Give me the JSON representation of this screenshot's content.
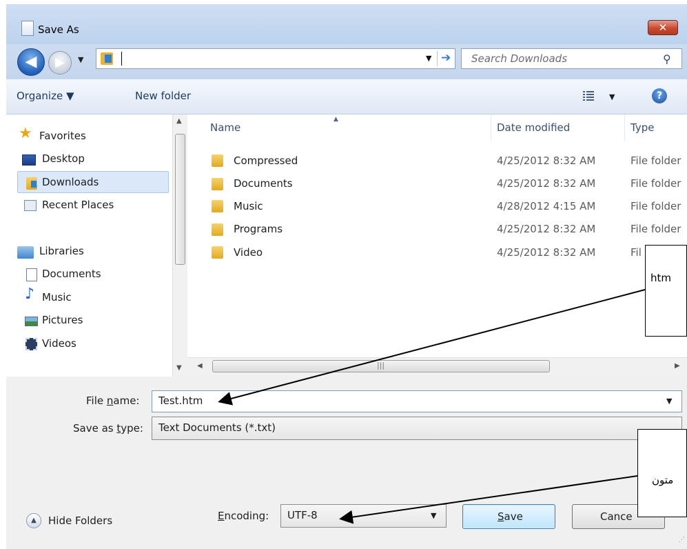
{
  "window": {
    "title": "Save As",
    "close_glyph": "✕"
  },
  "nav": {
    "back_glyph": "◀",
    "forward_glyph": "▶",
    "address_value": "",
    "search_placeholder": "Search Downloads"
  },
  "toolbar": {
    "organize_label": "Organize ▼",
    "new_folder_label": "New folder",
    "help_glyph": "?"
  },
  "sidebar": {
    "favorites_label": "Favorites",
    "items": [
      {
        "label": "Desktop",
        "icon": "desktop-icon"
      },
      {
        "label": "Downloads",
        "icon": "downloads-folder-icon"
      },
      {
        "label": "Recent Places",
        "icon": "recent-places-icon"
      }
    ],
    "libraries_label": "Libraries",
    "library_items": [
      {
        "label": "Documents",
        "icon": "document-icon"
      },
      {
        "label": "Music",
        "icon": "music-note-icon"
      },
      {
        "label": "Pictures",
        "icon": "picture-icon"
      },
      {
        "label": "Videos",
        "icon": "film-icon"
      }
    ]
  },
  "file_list": {
    "columns": [
      "Name",
      "Date modified",
      "Type"
    ],
    "rows": [
      {
        "name": "Compressed",
        "date": "4/25/2012 8:32 AM",
        "type": "File folder"
      },
      {
        "name": "Documents",
        "date": "4/25/2012 8:32 AM",
        "type": "File folder"
      },
      {
        "name": "Music",
        "date": "4/28/2012 4:15 AM",
        "type": "File folder"
      },
      {
        "name": "Programs",
        "date": "4/25/2012 8:32 AM",
        "type": "File folder"
      },
      {
        "name": "Video",
        "date": "4/25/2012 8:32 AM",
        "type": "Fil"
      }
    ]
  },
  "form": {
    "file_name_label_pre": "File ",
    "file_name_label_key": "n",
    "file_name_label_post": "ame:",
    "file_name_value": "Test.htm",
    "save_type_label_pre": "Save as ",
    "save_type_label_key": "t",
    "save_type_label_post": "ype:",
    "save_type_value": "Text Documents (*.txt)",
    "encoding_label_key": "E",
    "encoding_label_post": "ncoding:",
    "encoding_value": "UTF-8",
    "hide_folders_label": "Hide Folders",
    "save_label_key": "S",
    "save_label_post": "ave",
    "cancel_label": "Cance"
  },
  "callouts": {
    "top_text": "htm",
    "bottom_text": "متون"
  }
}
